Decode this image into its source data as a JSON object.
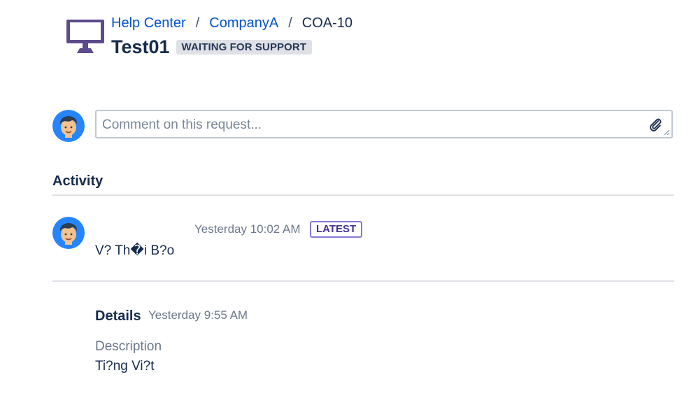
{
  "breadcrumb": {
    "items": [
      {
        "label": "Help Center"
      },
      {
        "label": "CompanyA"
      }
    ],
    "separator": "/",
    "current": "COA-10"
  },
  "request": {
    "title": "Test01",
    "status": "WAITING FOR SUPPORT",
    "icon": "desktop-monitor-icon"
  },
  "comment": {
    "placeholder": "Comment on this request...",
    "attach_icon": "paperclip-icon"
  },
  "activity": {
    "heading": "Activity",
    "entries": [
      {
        "timestamp": "Yesterday 10:02 AM",
        "badge": "LATEST",
        "text": "V? Th�i B?o"
      }
    ]
  },
  "details": {
    "label": "Details",
    "timestamp": "Yesterday 9:55 AM",
    "fields": [
      {
        "label": "Description",
        "value": "Ti?ng Vi?t"
      }
    ]
  },
  "colors": {
    "link": "#0052cc",
    "text": "#172b4d",
    "muted": "#6b778c",
    "avatar_bg": "#2684ff",
    "monitor": "#5e4b8b",
    "latest_border": "#8777d9",
    "latest_text": "#403294",
    "badge_bg": "#dfe1e6"
  }
}
